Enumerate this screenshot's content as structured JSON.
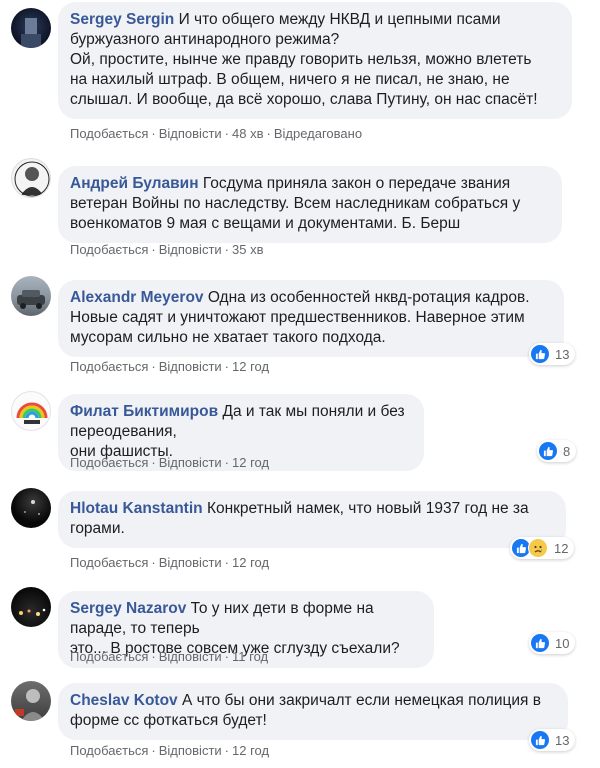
{
  "ui": {
    "like": "Подобається",
    "reply": "Відповісти",
    "edited": "Відредаговано",
    "dot": "·"
  },
  "colors": {
    "author": "#385898",
    "bubble": "#f0f2f5",
    "like": "#1877f2",
    "meta": "#65676b"
  },
  "comments": [
    {
      "author": "Sergey Sergin",
      "text": "И что общего между НКВД и цепными псами\nбуржуазного антинародного режима?\nОй, простите, нынче же правду говорить нельзя, можно влететь\nна нахилый штраф. В общем, ничего я не писал, не знаю, не\nслышал. И вообще, да всё хорошо, слава Путину, он нас спасёт!",
      "time": "48 хв",
      "edited": true
    },
    {
      "author": "Андрей Булавин",
      "text": "Госдума приняла закон о передаче звания\nветеран Войны по наследству. Всем наследникам собраться у\nвоенкоматов 9 мая с вещами и документами. Б. Берш",
      "time": "35 хв"
    },
    {
      "author": "Alexandr Meyerov",
      "text": "Одна из особенностей нквд-ротация кадров.\nНовые садят и уничтожают предшественников. Наверное этим\nмусорам сильно не хватает такого подхода.",
      "time": "12 год",
      "reactions": "13"
    },
    {
      "author": "Филат Биктимиров",
      "text": "Да и так мы поняли и без переодевания,\nони фашисты.",
      "time": "12 год",
      "reactions": "8"
    },
    {
      "author": "Hlotau Kanstantin",
      "text": "Конкретный намек, что новый 1937 год не за\nгорами.",
      "time": "12 год",
      "reactions": "12"
    },
    {
      "author": "Sergey Nazarov",
      "text": "То у них дети в форме на параде, то теперь\nэто... В ростове совсем уже сглузду съехали?",
      "time": "11 год",
      "reactions": "10"
    },
    {
      "author": "Cheslav Kotov",
      "text": "А что бы они закричалт если немецкая полиция в\nформе сс фоткаться будет!",
      "time": "12 год",
      "reactions": "13"
    }
  ]
}
